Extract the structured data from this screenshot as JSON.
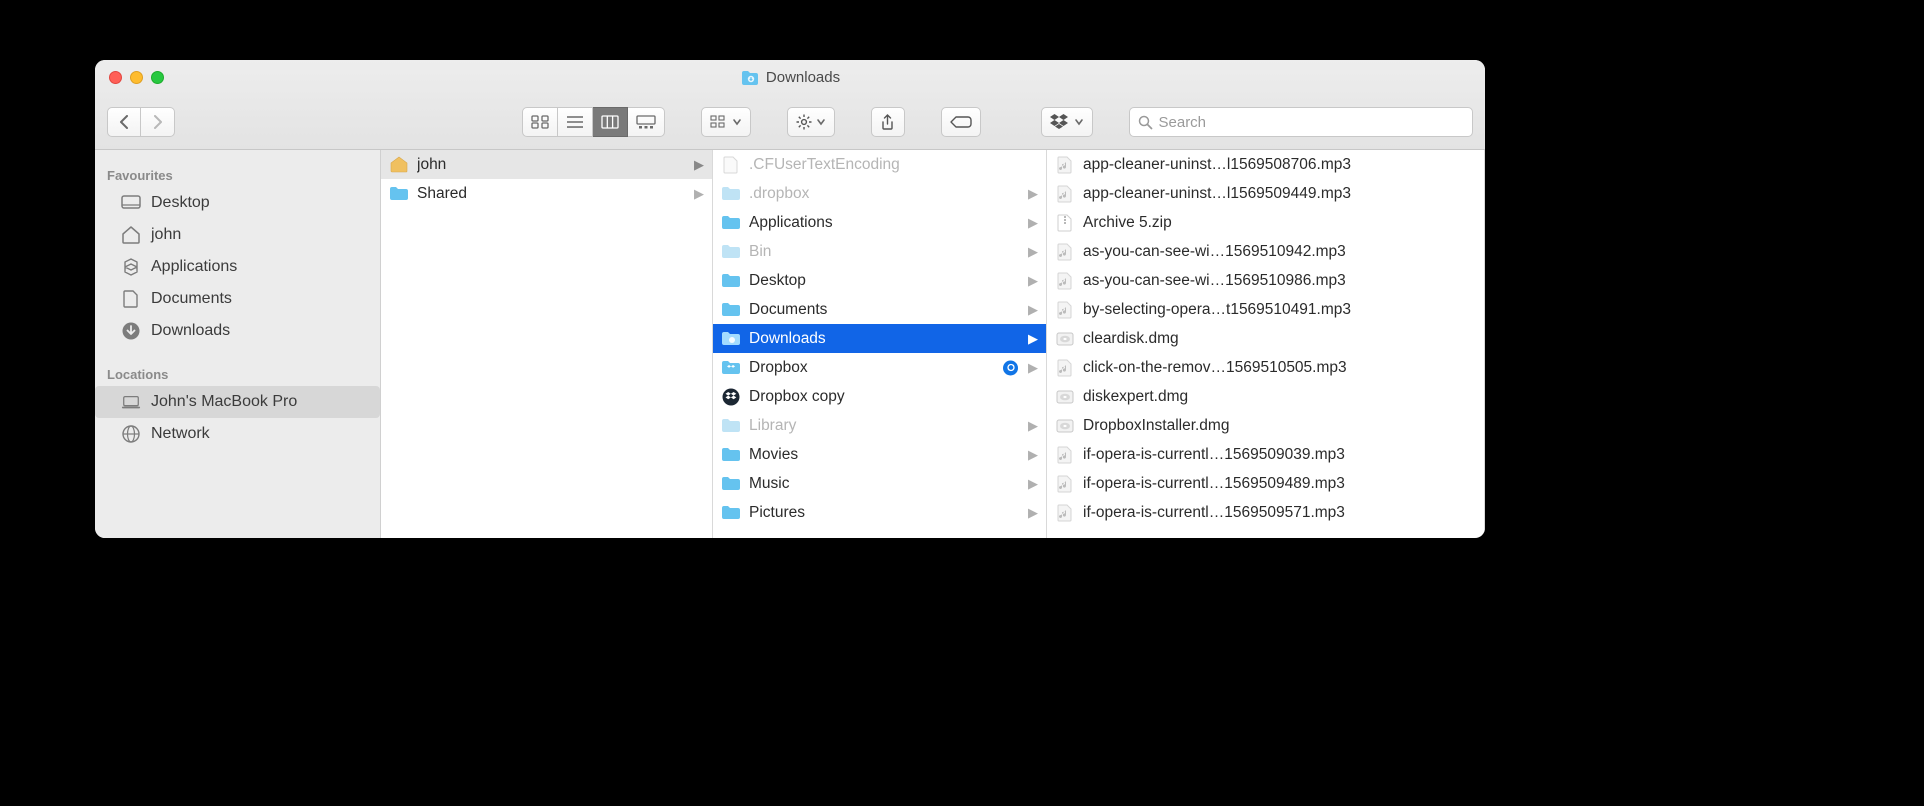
{
  "window": {
    "title": "Downloads"
  },
  "search": {
    "placeholder": "Search"
  },
  "sidebar": {
    "favourites_header": "Favourites",
    "locations_header": "Locations",
    "favourites": [
      {
        "label": "Desktop",
        "icon": "desktop-icon"
      },
      {
        "label": "john",
        "icon": "home-icon"
      },
      {
        "label": "Applications",
        "icon": "applications-icon"
      },
      {
        "label": "Documents",
        "icon": "documents-icon"
      },
      {
        "label": "Downloads",
        "icon": "downloads-icon"
      }
    ],
    "locations": [
      {
        "label": "John's MacBook Pro",
        "icon": "laptop-icon",
        "selected": true
      },
      {
        "label": "Network",
        "icon": "network-icon"
      }
    ]
  },
  "columns": {
    "a": [
      {
        "label": "john",
        "icon": "home-folder-icon",
        "arrow": true,
        "selected": true
      },
      {
        "label": "Shared",
        "icon": "folder-icon",
        "arrow": true
      }
    ],
    "b": [
      {
        "label": ".CFUserTextEncoding",
        "icon": "file-icon",
        "arrow": false,
        "dim": true
      },
      {
        "label": ".dropbox",
        "icon": "folder-dim-icon",
        "arrow": true,
        "dim": true
      },
      {
        "label": "Applications",
        "icon": "folder-icon",
        "arrow": true
      },
      {
        "label": "Bin",
        "icon": "folder-dim-icon",
        "arrow": true,
        "dim": true
      },
      {
        "label": "Desktop",
        "icon": "folder-icon",
        "arrow": true
      },
      {
        "label": "Documents",
        "icon": "folder-icon",
        "arrow": true
      },
      {
        "label": "Downloads",
        "icon": "downloads-folder-icon",
        "arrow": true,
        "selected_blue": true
      },
      {
        "label": "Dropbox",
        "icon": "dropbox-folder-icon",
        "arrow": true,
        "sync": true
      },
      {
        "label": "Dropbox copy",
        "icon": "dropbox-app-icon",
        "arrow": false
      },
      {
        "label": "Library",
        "icon": "folder-dim-icon",
        "arrow": true,
        "dim": true
      },
      {
        "label": "Movies",
        "icon": "folder-icon",
        "arrow": true
      },
      {
        "label": "Music",
        "icon": "folder-icon",
        "arrow": true
      },
      {
        "label": "Pictures",
        "icon": "folder-icon",
        "arrow": true
      }
    ],
    "c": [
      {
        "label": "app-cleaner-uninst…l1569508706.mp3",
        "icon": "audio-icon"
      },
      {
        "label": "app-cleaner-uninst…l1569509449.mp3",
        "icon": "audio-icon"
      },
      {
        "label": "Archive 5.zip",
        "icon": "zip-icon"
      },
      {
        "label": "as-you-can-see-wi…1569510942.mp3",
        "icon": "audio-icon"
      },
      {
        "label": "as-you-can-see-wi…1569510986.mp3",
        "icon": "audio-icon"
      },
      {
        "label": "by-selecting-opera…t1569510491.mp3",
        "icon": "audio-icon"
      },
      {
        "label": "cleardisk.dmg",
        "icon": "dmg-icon"
      },
      {
        "label": "click-on-the-remov…1569510505.mp3",
        "icon": "audio-icon"
      },
      {
        "label": "diskexpert.dmg",
        "icon": "dmg-icon"
      },
      {
        "label": "DropboxInstaller.dmg",
        "icon": "dmg-icon"
      },
      {
        "label": "if-opera-is-currentl…1569509039.mp3",
        "icon": "audio-icon"
      },
      {
        "label": "if-opera-is-currentl…1569509489.mp3",
        "icon": "audio-icon"
      },
      {
        "label": "if-opera-is-currentl…1569509571.mp3",
        "icon": "audio-icon"
      }
    ]
  }
}
